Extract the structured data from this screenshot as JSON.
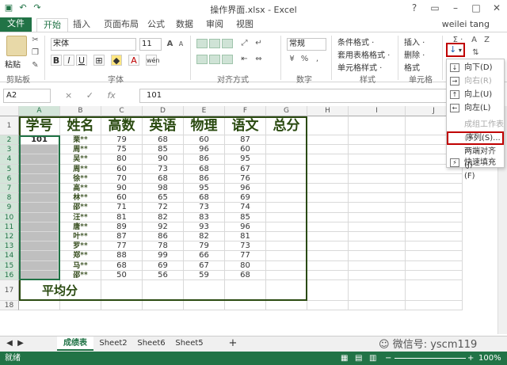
{
  "window": {
    "title": "操作界面.xlsx - Excel",
    "user": "weilei tang",
    "help": "?"
  },
  "qat": {
    "save_icon": "save-icon",
    "undo": "↶",
    "redo": "↷"
  },
  "tabs": [
    "文件",
    "开始",
    "插入",
    "页面布局",
    "公式",
    "数据",
    "审阅",
    "视图"
  ],
  "ribbon": {
    "clipboard": {
      "paste": "粘贴",
      "group": "剪贴板"
    },
    "font": {
      "name": "宋体",
      "size": "11",
      "bold": "B",
      "italic": "I",
      "underline": "U",
      "grow": "A",
      "shrink": "A",
      "color": "A",
      "wen": "wén",
      "group": "字体"
    },
    "alignment": {
      "group": "对齐方式"
    },
    "number": {
      "format": "常规",
      "percent": "%",
      "comma": ",",
      "group": "数字"
    },
    "styles": {
      "conditional": "条件格式 ·",
      "table": "套用表格格式 ·",
      "cell": "单元格样式 ·",
      "group": "样式"
    },
    "cells": {
      "insert": "插入 ·",
      "delete": "删除 ·",
      "format": "格式",
      "group": "单元格"
    },
    "editing": {
      "sum": "Σ ·",
      "sort": "A",
      "find": "Z"
    }
  },
  "formula_bar": {
    "name_box": "A2",
    "cancel": "×",
    "enter": "✓",
    "fx": "fx",
    "value": "101"
  },
  "columns": [
    "A",
    "B",
    "C",
    "D",
    "E",
    "F",
    "G",
    "H",
    "I",
    "J"
  ],
  "rows": [
    "1",
    "2",
    "3",
    "4",
    "5",
    "6",
    "7",
    "8",
    "9",
    "10",
    "11",
    "12",
    "13",
    "14",
    "15",
    "16",
    "17",
    "18"
  ],
  "table": {
    "headers": [
      "学号",
      "姓名",
      "高数",
      "英语",
      "物理",
      "语文",
      "总分"
    ],
    "first_id": "101",
    "names": [
      "栗**",
      "周**",
      "吴**",
      "周**",
      "徐**",
      "高**",
      "林**",
      "邵**",
      "汪**",
      "唐**",
      "叶**",
      "罗**",
      "郑**",
      "马**",
      "邵**"
    ],
    "scores": [
      [
        "79",
        "68",
        "60",
        "87"
      ],
      [
        "75",
        "85",
        "96",
        "60"
      ],
      [
        "80",
        "90",
        "86",
        "95"
      ],
      [
        "60",
        "73",
        "68",
        "67"
      ],
      [
        "70",
        "68",
        "86",
        "76"
      ],
      [
        "90",
        "98",
        "95",
        "96"
      ],
      [
        "60",
        "65",
        "68",
        "69"
      ],
      [
        "71",
        "72",
        "73",
        "74"
      ],
      [
        "81",
        "82",
        "83",
        "85"
      ],
      [
        "89",
        "92",
        "93",
        "96"
      ],
      [
        "87",
        "86",
        "82",
        "81"
      ],
      [
        "77",
        "78",
        "79",
        "73"
      ],
      [
        "88",
        "99",
        "66",
        "77"
      ],
      [
        "68",
        "69",
        "67",
        "80"
      ],
      [
        "50",
        "56",
        "59",
        "68"
      ]
    ],
    "average_label": "平均分"
  },
  "fill_menu": {
    "items": [
      {
        "label": "向下(D)",
        "icon": "arrow-down-icon",
        "glyph": "↓",
        "disabled": false
      },
      {
        "label": "向右(R)",
        "icon": "arrow-right-icon",
        "glyph": "→",
        "disabled": true
      },
      {
        "label": "向上(U)",
        "icon": "arrow-up-icon",
        "glyph": "↑",
        "disabled": false
      },
      {
        "label": "向左(L)",
        "icon": "arrow-left-icon",
        "glyph": "←",
        "disabled": false
      },
      {
        "label": "成组工作表(A)...",
        "icon": "",
        "glyph": "",
        "disabled": true
      },
      {
        "label": "序列(S)...",
        "icon": "",
        "glyph": "",
        "disabled": false,
        "highlighted": true
      },
      {
        "label": "两端对齐(J)",
        "icon": "",
        "glyph": "",
        "disabled": false
      },
      {
        "label": "快速填充(F)",
        "icon": "flash-fill-icon",
        "glyph": "⚡",
        "disabled": false
      }
    ]
  },
  "sheets": [
    "成绩表",
    "Sheet2",
    "Sheet6",
    "Sheet5"
  ],
  "add_sheet": "+",
  "watermark": "微信号: yscm119",
  "status": {
    "mode": "就绪",
    "zoom": "100%"
  },
  "colors": {
    "excel_green": "#217346",
    "highlight_red": "#c00000"
  }
}
